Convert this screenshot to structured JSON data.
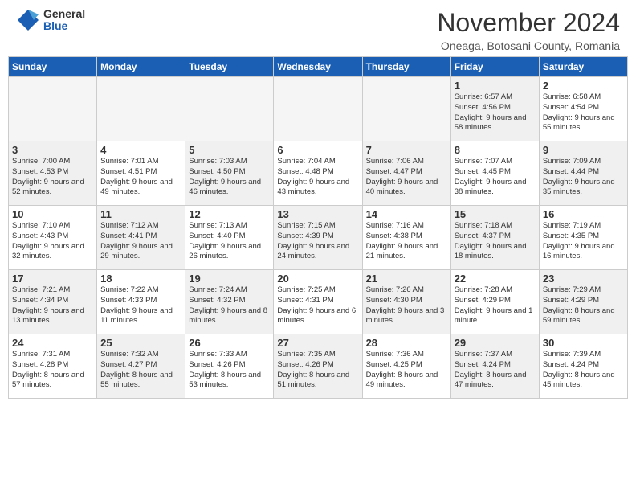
{
  "logo": {
    "general": "General",
    "blue": "Blue"
  },
  "title": "November 2024",
  "location": "Oneaga, Botosani County, Romania",
  "days_of_week": [
    "Sunday",
    "Monday",
    "Tuesday",
    "Wednesday",
    "Thursday",
    "Friday",
    "Saturday"
  ],
  "weeks": [
    [
      {
        "day": "",
        "info": "",
        "empty": true
      },
      {
        "day": "",
        "info": "",
        "empty": true
      },
      {
        "day": "",
        "info": "",
        "empty": true
      },
      {
        "day": "",
        "info": "",
        "empty": true
      },
      {
        "day": "",
        "info": "",
        "empty": true
      },
      {
        "day": "1",
        "info": "Sunrise: 6:57 AM\nSunset: 4:56 PM\nDaylight: 9 hours and 58 minutes.",
        "empty": false,
        "shaded": true
      },
      {
        "day": "2",
        "info": "Sunrise: 6:58 AM\nSunset: 4:54 PM\nDaylight: 9 hours and 55 minutes.",
        "empty": false,
        "shaded": false
      }
    ],
    [
      {
        "day": "3",
        "info": "Sunrise: 7:00 AM\nSunset: 4:53 PM\nDaylight: 9 hours and 52 minutes.",
        "empty": false,
        "shaded": true
      },
      {
        "day": "4",
        "info": "Sunrise: 7:01 AM\nSunset: 4:51 PM\nDaylight: 9 hours and 49 minutes.",
        "empty": false,
        "shaded": false
      },
      {
        "day": "5",
        "info": "Sunrise: 7:03 AM\nSunset: 4:50 PM\nDaylight: 9 hours and 46 minutes.",
        "empty": false,
        "shaded": true
      },
      {
        "day": "6",
        "info": "Sunrise: 7:04 AM\nSunset: 4:48 PM\nDaylight: 9 hours and 43 minutes.",
        "empty": false,
        "shaded": false
      },
      {
        "day": "7",
        "info": "Sunrise: 7:06 AM\nSunset: 4:47 PM\nDaylight: 9 hours and 40 minutes.",
        "empty": false,
        "shaded": true
      },
      {
        "day": "8",
        "info": "Sunrise: 7:07 AM\nSunset: 4:45 PM\nDaylight: 9 hours and 38 minutes.",
        "empty": false,
        "shaded": false
      },
      {
        "day": "9",
        "info": "Sunrise: 7:09 AM\nSunset: 4:44 PM\nDaylight: 9 hours and 35 minutes.",
        "empty": false,
        "shaded": true
      }
    ],
    [
      {
        "day": "10",
        "info": "Sunrise: 7:10 AM\nSunset: 4:43 PM\nDaylight: 9 hours and 32 minutes.",
        "empty": false,
        "shaded": false
      },
      {
        "day": "11",
        "info": "Sunrise: 7:12 AM\nSunset: 4:41 PM\nDaylight: 9 hours and 29 minutes.",
        "empty": false,
        "shaded": true
      },
      {
        "day": "12",
        "info": "Sunrise: 7:13 AM\nSunset: 4:40 PM\nDaylight: 9 hours and 26 minutes.",
        "empty": false,
        "shaded": false
      },
      {
        "day": "13",
        "info": "Sunrise: 7:15 AM\nSunset: 4:39 PM\nDaylight: 9 hours and 24 minutes.",
        "empty": false,
        "shaded": true
      },
      {
        "day": "14",
        "info": "Sunrise: 7:16 AM\nSunset: 4:38 PM\nDaylight: 9 hours and 21 minutes.",
        "empty": false,
        "shaded": false
      },
      {
        "day": "15",
        "info": "Sunrise: 7:18 AM\nSunset: 4:37 PM\nDaylight: 9 hours and 18 minutes.",
        "empty": false,
        "shaded": true
      },
      {
        "day": "16",
        "info": "Sunrise: 7:19 AM\nSunset: 4:35 PM\nDaylight: 9 hours and 16 minutes.",
        "empty": false,
        "shaded": false
      }
    ],
    [
      {
        "day": "17",
        "info": "Sunrise: 7:21 AM\nSunset: 4:34 PM\nDaylight: 9 hours and 13 minutes.",
        "empty": false,
        "shaded": true
      },
      {
        "day": "18",
        "info": "Sunrise: 7:22 AM\nSunset: 4:33 PM\nDaylight: 9 hours and 11 minutes.",
        "empty": false,
        "shaded": false
      },
      {
        "day": "19",
        "info": "Sunrise: 7:24 AM\nSunset: 4:32 PM\nDaylight: 9 hours and 8 minutes.",
        "empty": false,
        "shaded": true
      },
      {
        "day": "20",
        "info": "Sunrise: 7:25 AM\nSunset: 4:31 PM\nDaylight: 9 hours and 6 minutes.",
        "empty": false,
        "shaded": false
      },
      {
        "day": "21",
        "info": "Sunrise: 7:26 AM\nSunset: 4:30 PM\nDaylight: 9 hours and 3 minutes.",
        "empty": false,
        "shaded": true
      },
      {
        "day": "22",
        "info": "Sunrise: 7:28 AM\nSunset: 4:29 PM\nDaylight: 9 hours and 1 minute.",
        "empty": false,
        "shaded": false
      },
      {
        "day": "23",
        "info": "Sunrise: 7:29 AM\nSunset: 4:29 PM\nDaylight: 8 hours and 59 minutes.",
        "empty": false,
        "shaded": true
      }
    ],
    [
      {
        "day": "24",
        "info": "Sunrise: 7:31 AM\nSunset: 4:28 PM\nDaylight: 8 hours and 57 minutes.",
        "empty": false,
        "shaded": false
      },
      {
        "day": "25",
        "info": "Sunrise: 7:32 AM\nSunset: 4:27 PM\nDaylight: 8 hours and 55 minutes.",
        "empty": false,
        "shaded": true
      },
      {
        "day": "26",
        "info": "Sunrise: 7:33 AM\nSunset: 4:26 PM\nDaylight: 8 hours and 53 minutes.",
        "empty": false,
        "shaded": false
      },
      {
        "day": "27",
        "info": "Sunrise: 7:35 AM\nSunset: 4:26 PM\nDaylight: 8 hours and 51 minutes.",
        "empty": false,
        "shaded": true
      },
      {
        "day": "28",
        "info": "Sunrise: 7:36 AM\nSunset: 4:25 PM\nDaylight: 8 hours and 49 minutes.",
        "empty": false,
        "shaded": false
      },
      {
        "day": "29",
        "info": "Sunrise: 7:37 AM\nSunset: 4:24 PM\nDaylight: 8 hours and 47 minutes.",
        "empty": false,
        "shaded": true
      },
      {
        "day": "30",
        "info": "Sunrise: 7:39 AM\nSunset: 4:24 PM\nDaylight: 8 hours and 45 minutes.",
        "empty": false,
        "shaded": false
      }
    ]
  ]
}
